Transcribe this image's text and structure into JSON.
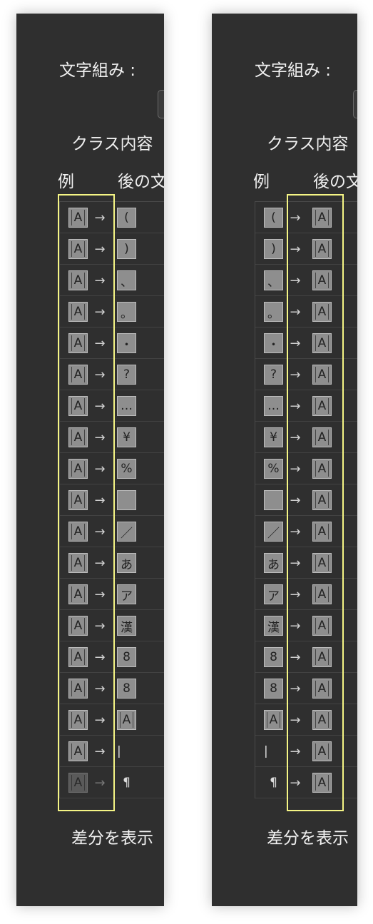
{
  "labels": {
    "heading": "文字組み :",
    "subhead": "クラス内容",
    "col_example": "例",
    "col_after": "後の文",
    "diff": "差分を表示",
    "arrow": "→"
  },
  "colors": {
    "panel": "#2f2f2f",
    "highlight": "#f5f585",
    "cell": "#8e8e8e"
  },
  "rows": [
    {
      "char": "(",
      "kind": "bracket-open"
    },
    {
      "char": ")",
      "kind": "bracket-close"
    },
    {
      "char": "、",
      "kind": "comma"
    },
    {
      "char": "。",
      "kind": "period"
    },
    {
      "char": "・",
      "kind": "middot"
    },
    {
      "char": "?",
      "kind": "full"
    },
    {
      "char": "…",
      "kind": "full"
    },
    {
      "char": "¥",
      "kind": "full"
    },
    {
      "char": "%",
      "kind": "full"
    },
    {
      "char": "",
      "kind": "full"
    },
    {
      "char": "／",
      "kind": "full"
    },
    {
      "char": "あ",
      "kind": "full"
    },
    {
      "char": "ア",
      "kind": "full"
    },
    {
      "char": "漢",
      "kind": "full"
    },
    {
      "char": "8",
      "kind": "full"
    },
    {
      "char": "8",
      "kind": "half"
    },
    {
      "char": "A",
      "kind": "latin"
    },
    {
      "char": "|",
      "kind": "bar"
    },
    {
      "char": "¶",
      "kind": "pilcrow"
    }
  ],
  "example_char": "A"
}
